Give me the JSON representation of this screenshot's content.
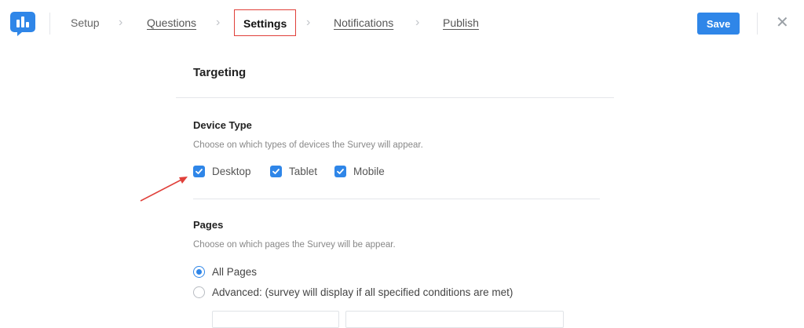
{
  "header": {
    "steps": [
      {
        "label": "Setup"
      },
      {
        "label": "Questions"
      },
      {
        "label": "Settings"
      },
      {
        "label": "Notifications"
      },
      {
        "label": "Publish"
      }
    ],
    "save_label": "Save",
    "close_glyph": "✕",
    "chevron_glyph": "›"
  },
  "main": {
    "title": "Targeting",
    "device_type": {
      "heading": "Device Type",
      "description": "Choose on which types of devices the Survey will appear.",
      "options": [
        {
          "label": "Desktop",
          "checked": true
        },
        {
          "label": "Tablet",
          "checked": true
        },
        {
          "label": "Mobile",
          "checked": true
        }
      ]
    },
    "pages": {
      "heading": "Pages",
      "description": "Choose on which pages the Survey will be appear.",
      "options": [
        {
          "label": "All Pages",
          "selected": true
        },
        {
          "label": "Advanced: (survey will display if all specified conditions are met)",
          "selected": false
        }
      ]
    }
  },
  "colors": {
    "accent": "#2f86e8",
    "highlight": "#e0403a"
  },
  "icons": {
    "logo": "chart-bubble-logo-icon",
    "checkbox": "checkmark-icon",
    "close": "close-icon",
    "annotation": "arrow-annotation"
  }
}
